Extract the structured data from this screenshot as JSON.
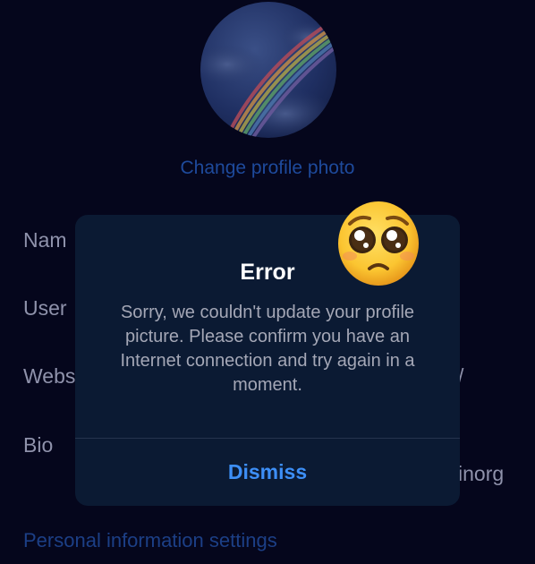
{
  "profile": {
    "change_photo_label": "Change profile photo"
  },
  "fields": {
    "name_label_visible": "Nam",
    "username_label_visible": "User",
    "website_label_visible": "Webs",
    "website_value_visible": "/",
    "bio_label": "Bio",
    "bio_value_visible": "inorg"
  },
  "settings_link_label": "Personal information settings",
  "dialog": {
    "title": "Error",
    "message": "Sorry, we couldn't update your profile picture. Please confirm you have an Internet connection and try again in a moment.",
    "dismiss_label": "Dismiss"
  },
  "colors": {
    "background": "#05061c",
    "dialog_background": "#0b1a33",
    "accent_blue": "#3d8ff7",
    "link_blue_dimmed": "#1e4a9c",
    "emoji_yellow": "#fbc531"
  },
  "overlay_emoji": "pleading-face"
}
